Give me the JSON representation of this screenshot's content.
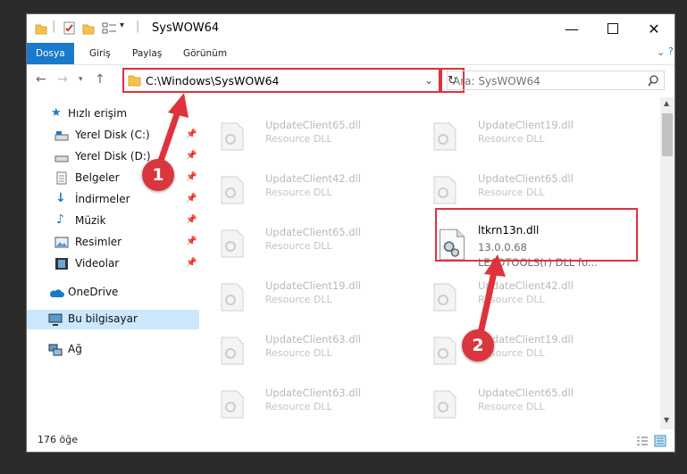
{
  "window": {
    "title": "SysWOW64"
  },
  "ribbon": {
    "tabs": [
      "Dosya",
      "Giriş",
      "Paylaş",
      "Görünüm"
    ],
    "active_tab": "Dosya"
  },
  "address": {
    "path": "C:\\Windows\\SysWOW64",
    "placeholder": "Ara: SysWOW64"
  },
  "sidebar": {
    "items": [
      {
        "label": "Hızlı erişim",
        "icon": "star-icon",
        "pinned": false
      },
      {
        "label": "Yerel Disk (C:)",
        "icon": "drive-icon",
        "pinned": true
      },
      {
        "label": "Yerel Disk (D:)",
        "icon": "drive-icon",
        "pinned": true
      },
      {
        "label": "Belgeler",
        "icon": "documents-icon",
        "pinned": true
      },
      {
        "label": "İndirmeler",
        "icon": "download-icon",
        "pinned": true
      },
      {
        "label": "Müzik",
        "icon": "music-icon",
        "pinned": true
      },
      {
        "label": "Resimler",
        "icon": "pictures-icon",
        "pinned": true
      },
      {
        "label": "Videolar",
        "icon": "video-icon",
        "pinned": true
      },
      {
        "label": "OneDrive",
        "icon": "cloud-icon",
        "pinned": false
      },
      {
        "label": "Bu bilgisayar",
        "icon": "computer-icon",
        "pinned": false,
        "selected": true
      },
      {
        "label": "Ağ",
        "icon": "network-icon",
        "pinned": false
      }
    ]
  },
  "files": {
    "left_column": [
      {
        "name": "UpdateClient65.dll",
        "desc": "Resource DLL"
      },
      {
        "name": "UpdateClient42.dll",
        "desc": "Resource DLL"
      },
      {
        "name": "UpdateClient65.dll",
        "desc": "Resource DLL"
      },
      {
        "name": "UpdateClient19.dll",
        "desc": "Resource DLL"
      },
      {
        "name": "UpdateClient63.dll",
        "desc": "Resource DLL"
      },
      {
        "name": "UpdateClient63.dll",
        "desc": "Resource DLL"
      }
    ],
    "right_column": [
      {
        "name": "UpdateClient19.dll",
        "desc": "Resource DLL"
      },
      {
        "name": "UpdateClient65.dll",
        "desc": "Resource DLL"
      },
      {
        "name": "UpdateClient42.dll",
        "desc": "Resource DLL"
      },
      {
        "name": "UpdateClient19.dll",
        "desc": "Resource DLL"
      },
      {
        "name": "UpdateClient65.dll",
        "desc": "Resource DLL"
      }
    ],
    "highlighted": {
      "name": "ltkrn13n.dll",
      "version": "13.0.0.68",
      "description": "LEADTOOLS(r) DLL fo..."
    }
  },
  "status": {
    "item_count": "176 öğe"
  },
  "annotations": {
    "step1": "1",
    "step2": "2",
    "color": "#e0323c"
  }
}
